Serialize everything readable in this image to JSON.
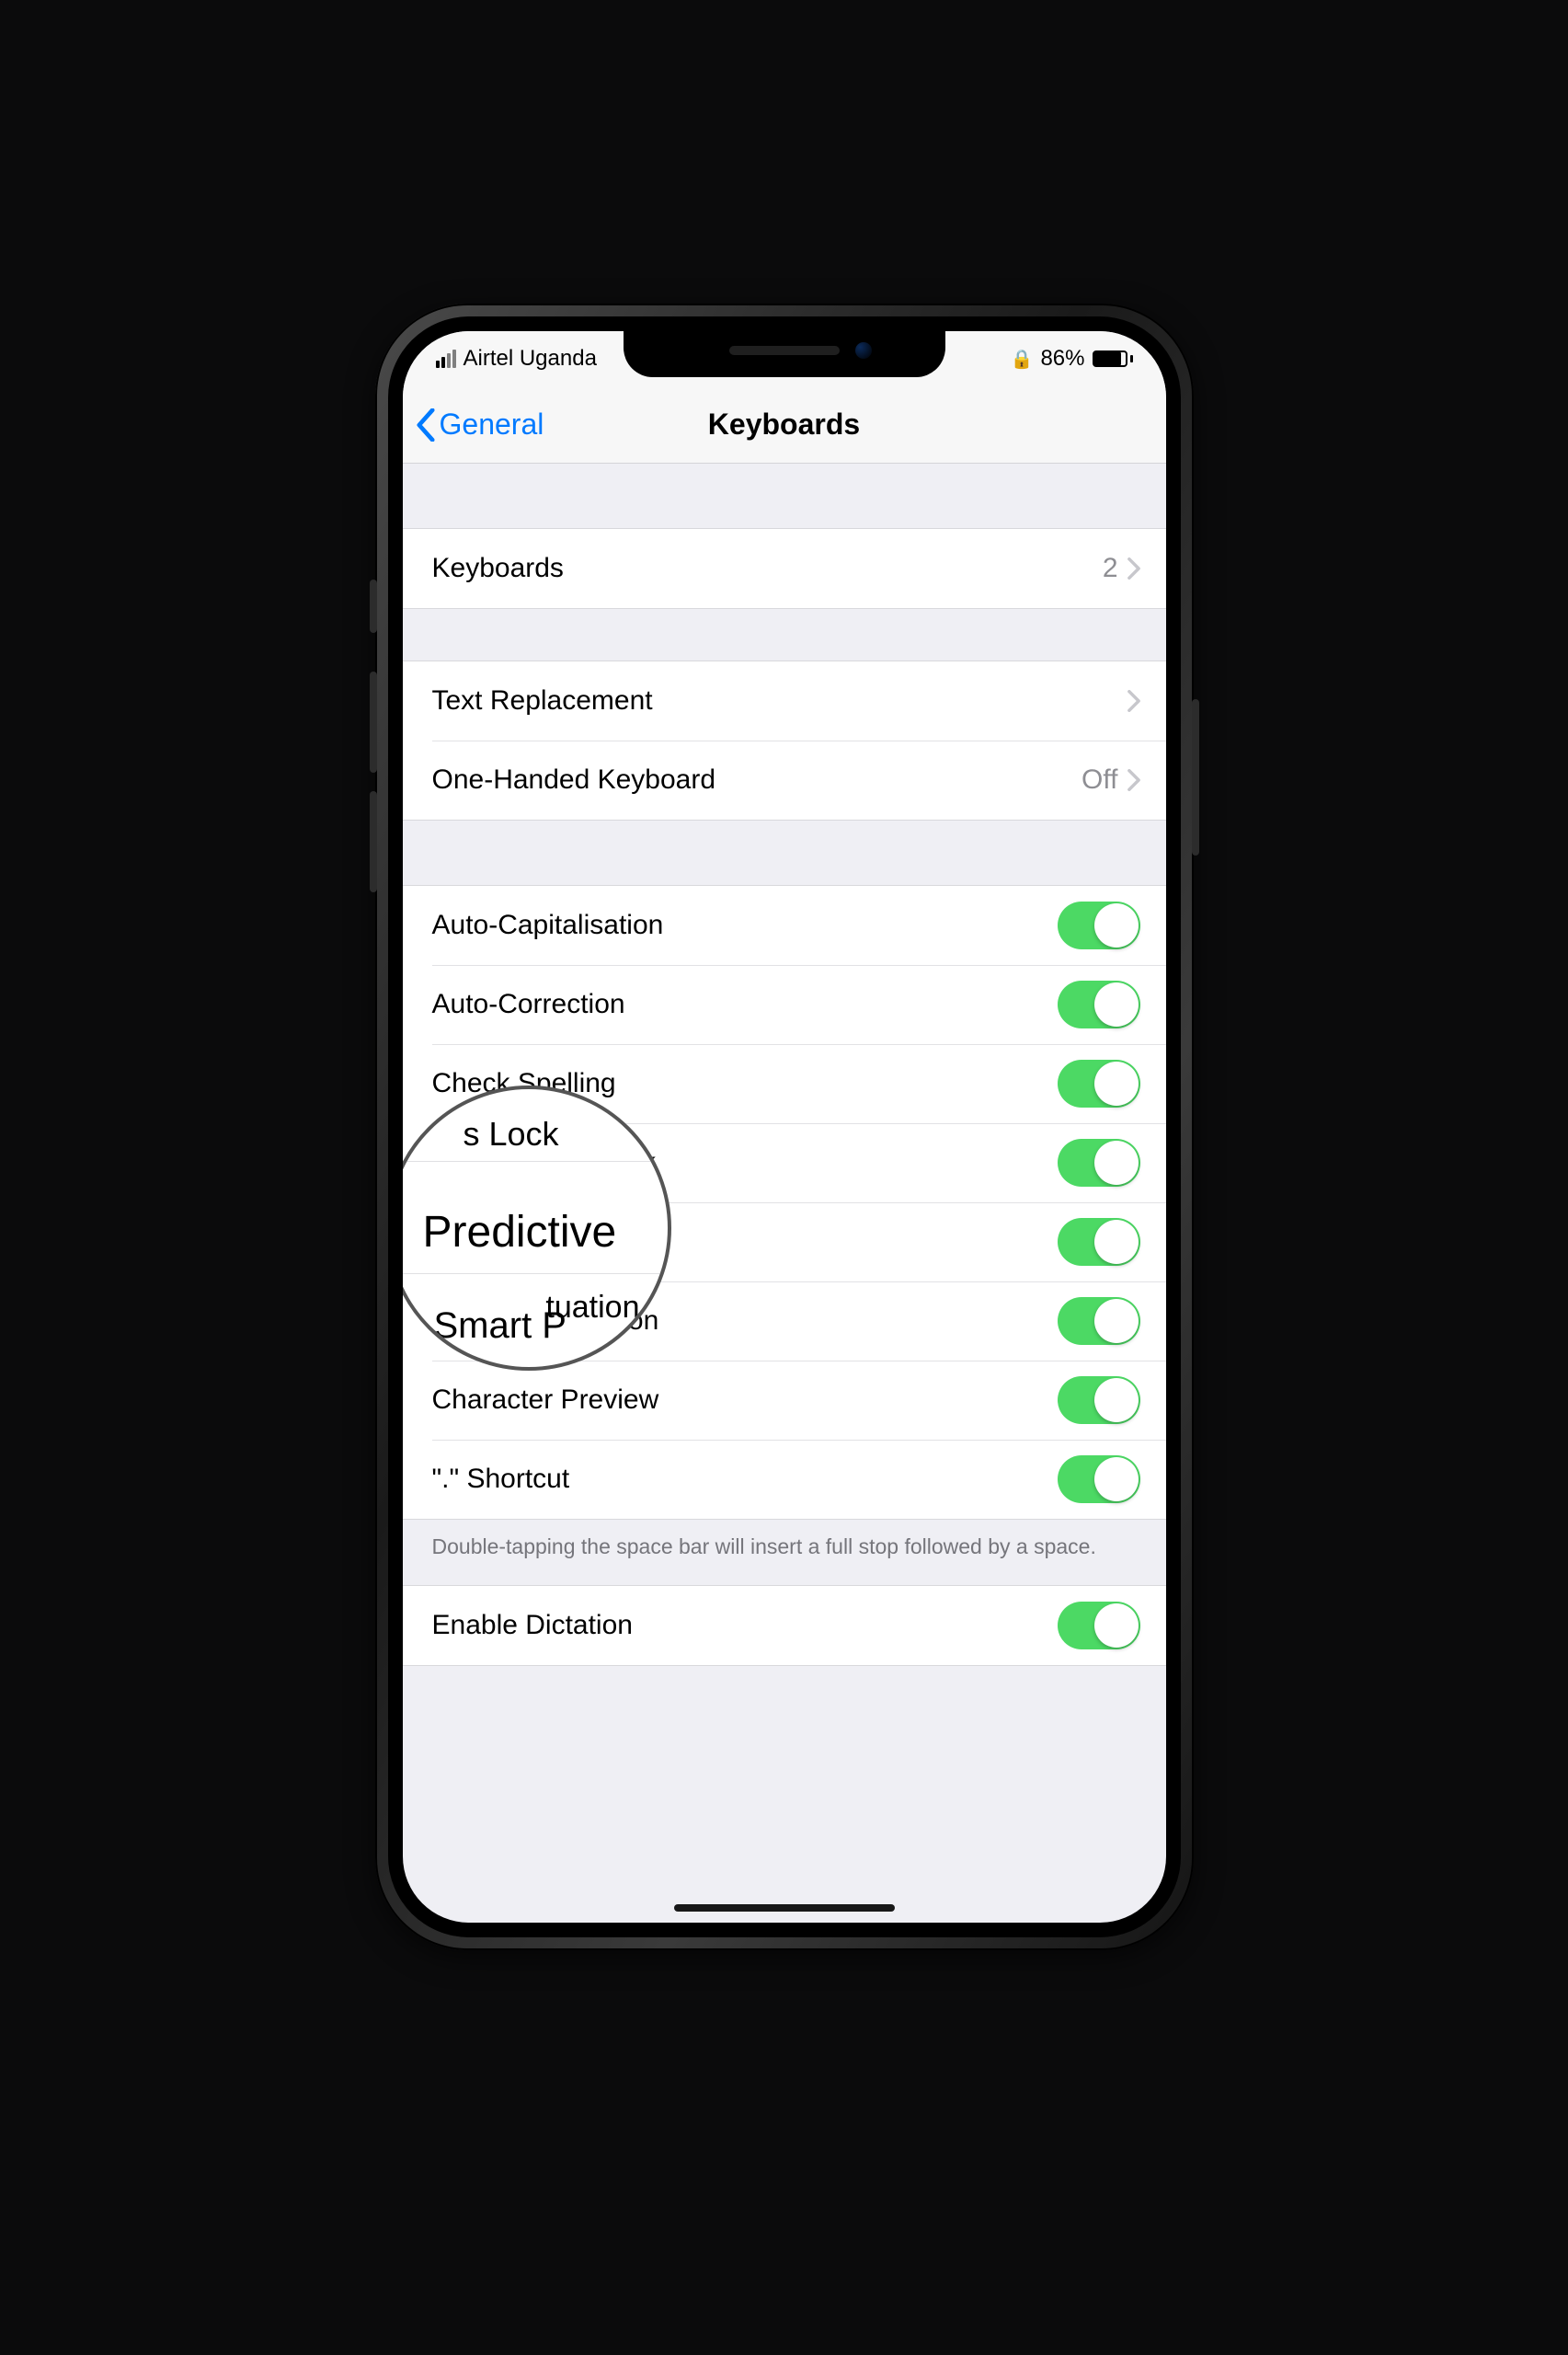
{
  "status": {
    "carrier": "Airtel Uganda",
    "battery_pct": "86%"
  },
  "nav": {
    "back_label": "General",
    "title": "Keyboards"
  },
  "rows": {
    "keyboards": {
      "label": "Keyboards",
      "value": "2"
    },
    "text_replacement": {
      "label": "Text Replacement"
    },
    "one_handed": {
      "label": "One-Handed Keyboard",
      "value": "Off"
    }
  },
  "toggles": {
    "auto_cap": "Auto-Capitalisation",
    "auto_correct": "Auto-Correction",
    "check_spelling": "Check Spelling",
    "caps_lock": "Enable Caps Lock",
    "predictive": "Predictive",
    "smart_punct": "Smart Punctuation",
    "char_preview": "Character Preview",
    "shortcut": "\".\" Shortcut"
  },
  "footer": {
    "shortcut_note": "Double-tapping the space bar will insert a full stop followed by a space."
  },
  "dictation": {
    "enable": "Enable Dictation"
  },
  "magnifier": {
    "top_fragment": "s Lock",
    "focus": "Predictive",
    "bottom_fragment": "Smart P",
    "right_fragment": "tuation"
  }
}
